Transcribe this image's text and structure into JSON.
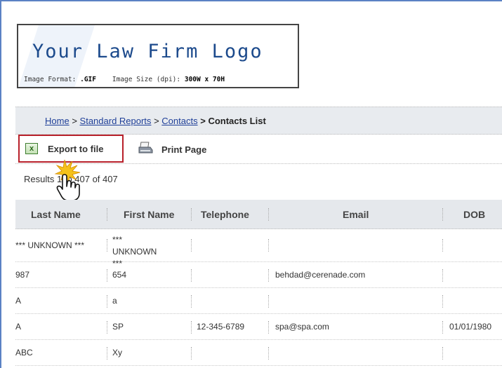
{
  "logo": {
    "title": "Your Law Firm Logo",
    "format_label": "Image Format:",
    "format_value": ".GIF",
    "size_label": "Image Size (dpi):",
    "size_value": "300W x 70H"
  },
  "breadcrumb": {
    "home": "Home",
    "sep1": ">",
    "standard_reports": "Standard Reports",
    "sep2": ">",
    "contacts": "Contacts",
    "sep3": ">",
    "current": "Contacts List"
  },
  "toolbar": {
    "export_label": "Export to file",
    "print_label": "Print Page"
  },
  "results": {
    "prefix": "Results",
    "range": "1 to 407 of 407"
  },
  "table": {
    "columns": [
      "Last Name",
      "First Name",
      "Telephone",
      "Email",
      "DOB"
    ],
    "rows": [
      [
        "*** UNKNOWN ***",
        "*** UNKNOWN ***",
        "",
        "",
        ""
      ],
      [
        "987",
        "654",
        "",
        "behdad@cerenade.com",
        ""
      ],
      [
        "A",
        "a",
        "",
        "",
        ""
      ],
      [
        "A",
        "SP",
        "12-345-6789",
        "spa@spa.com",
        "01/01/1980"
      ],
      [
        "ABC",
        "Xy",
        "",
        "",
        ""
      ]
    ]
  },
  "colors": {
    "frame_border": "#5b82c4",
    "logo_text": "#1c4a8c",
    "link": "#1f3f98",
    "highlight_border": "#b8202a",
    "header_bg": "#e5e8ec"
  },
  "icons": {
    "export": "excel-icon",
    "print": "printer-icon",
    "cursor": "hand-pointer-icon"
  }
}
